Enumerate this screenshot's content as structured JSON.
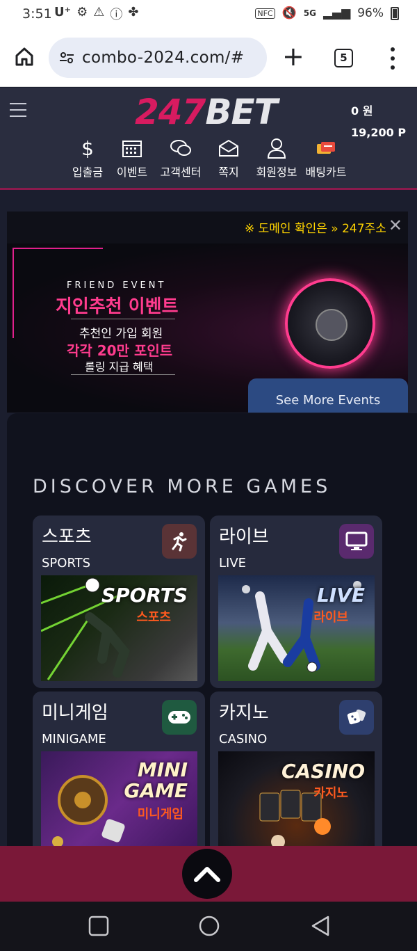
{
  "status": {
    "time": "3:51",
    "carrier": "U⁺",
    "network": "5G",
    "battery": "96%"
  },
  "browser": {
    "url": "combo-2024.com/#",
    "tab_count": "5"
  },
  "site": {
    "logo_num": "247",
    "logo_text": "BET",
    "balance_won": "0 원",
    "balance_points": "19,200 P",
    "nav": [
      {
        "label": "입출금",
        "icon": "dollar-icon"
      },
      {
        "label": "이벤트",
        "icon": "calendar-icon"
      },
      {
        "label": "고객센터",
        "icon": "chat-icon"
      },
      {
        "label": "쪽지",
        "icon": "mail-icon"
      },
      {
        "label": "회원정보",
        "icon": "user-icon"
      },
      {
        "label": "배팅카트",
        "icon": "ticket-icon"
      }
    ]
  },
  "banner": {
    "marquee": "※ 도메인 확인은 » 247주소",
    "friend_event": "FRIEND EVENT",
    "title": "지인추천 이벤트",
    "line1": "추천인 가입 회원",
    "line2": "각각 20만 포인트",
    "line3": "롤링 지급 혜택",
    "see_more": "See More Events"
  },
  "games": {
    "title": "DISCOVER MORE GAMES",
    "cards": [
      {
        "ko": "스포츠",
        "en": "SPORTS",
        "thumb_title": "SPORTS",
        "thumb_sub": "스포츠",
        "icon_color": "#5a3336"
      },
      {
        "ko": "라이브",
        "en": "LIVE",
        "thumb_title": "LIVE",
        "thumb_sub": "라이브",
        "icon_color": "#5a2a6e"
      },
      {
        "ko": "미니게임",
        "en": "MINIGAME",
        "thumb_title": "MINI GAME",
        "thumb_sub": "미니게임",
        "icon_color": "#1f5a40"
      },
      {
        "ko": "카지노",
        "en": "CASINO",
        "thumb_title": "CASINO",
        "thumb_sub": "카지노",
        "icon_color": "#2e3f6e"
      }
    ]
  },
  "colors": {
    "brand_pink": "#d81b60",
    "header_bg": "#2a2d3f",
    "bottom_bar": "#7a1838",
    "marquee_yellow": "#ffd400"
  }
}
